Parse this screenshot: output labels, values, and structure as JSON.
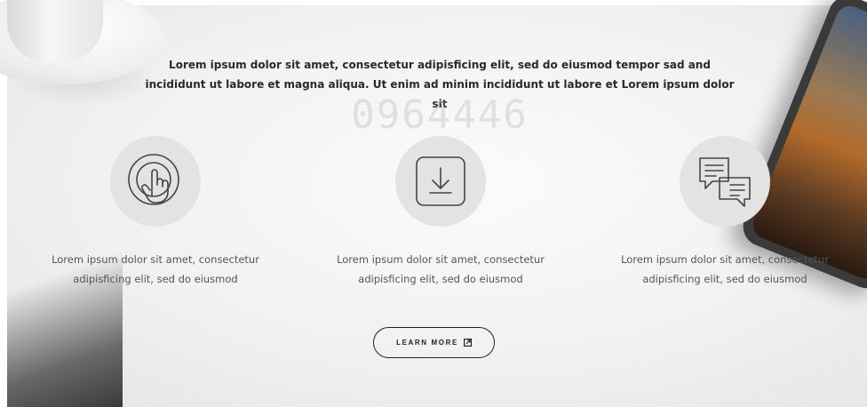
{
  "headline": "Lorem ipsum dolor sit amet, consectetur adipisficing elit, sed do eiusmod tempor sad and incididunt ut labore et magna aliqua. Ut enim ad minim incididunt ut labore et Lorem ipsum dolor sit",
  "watermark": "0964446",
  "features": [
    {
      "icon": "touch-icon",
      "text": "Lorem ipsum dolor sit amet, consectetur adipisficing elit, sed do eiusmod"
    },
    {
      "icon": "download-icon",
      "text": "Lorem ipsum dolor sit amet, consectetur adipisficing elit, sed do eiusmod"
    },
    {
      "icon": "chat-icon",
      "text": "Lorem ipsum dolor sit amet, consectetur adipisficing elit, sed do eiusmod"
    }
  ],
  "cta": {
    "label": "LEARN MORE",
    "icon": "external-link-icon"
  }
}
